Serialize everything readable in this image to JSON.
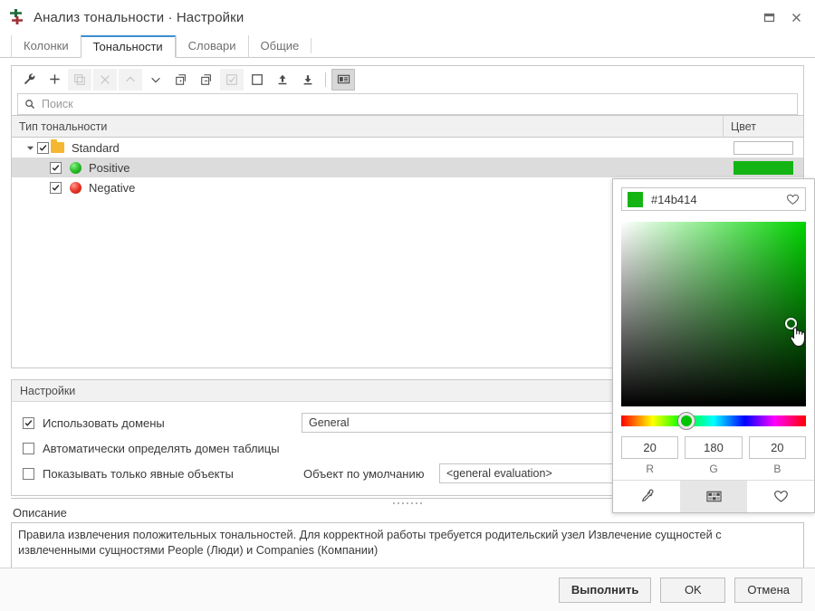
{
  "window": {
    "title": "Анализ тональности · Настройки",
    "app_icon": "sentiment-analysis-icon",
    "controls": {
      "maximize": "maximize-icon",
      "close": "close-icon"
    }
  },
  "tabs": [
    {
      "label": "Колонки",
      "active": false
    },
    {
      "label": "Тональности",
      "active": true
    },
    {
      "label": "Словари",
      "active": false
    },
    {
      "label": "Общие",
      "active": false
    }
  ],
  "toolbar": {
    "buttons": [
      {
        "icon": "wrench-icon",
        "state": "enabled"
      },
      {
        "icon": "plus-icon",
        "state": "enabled"
      },
      {
        "icon": "copy-icon",
        "state": "disabled"
      },
      {
        "icon": "delete-x-icon",
        "state": "disabled"
      },
      {
        "icon": "chevron-up-icon",
        "state": "disabled"
      },
      {
        "icon": "chevron-down-icon",
        "state": "enabled"
      },
      {
        "icon": "duplicate-add-icon",
        "state": "enabled"
      },
      {
        "icon": "duplicate-remove-icon",
        "state": "enabled"
      },
      {
        "icon": "checkbox-checked-icon",
        "state": "disabled"
      },
      {
        "icon": "checkbox-empty-icon",
        "state": "enabled"
      },
      {
        "icon": "upload-icon",
        "state": "enabled"
      },
      {
        "icon": "download-icon",
        "state": "enabled"
      },
      {
        "icon": "card-view-icon",
        "state": "pressed"
      }
    ]
  },
  "search": {
    "placeholder": "Поиск",
    "value": "",
    "icon": "search-icon"
  },
  "table": {
    "columns": [
      {
        "label": "Тип тональности"
      },
      {
        "label": "Цвет"
      }
    ],
    "rows": [
      {
        "label": "Standard",
        "icon": "folder-icon",
        "checked": true,
        "expanded": true,
        "level": 0,
        "selected": false,
        "color": ""
      },
      {
        "label": "Positive",
        "icon": "green-dot-icon",
        "checked": true,
        "level": 1,
        "selected": true,
        "color": "#14b414"
      },
      {
        "label": "Negative",
        "icon": "red-dot-icon",
        "checked": true,
        "level": 1,
        "selected": false,
        "color": ""
      }
    ]
  },
  "settings": {
    "header": "Настройки",
    "use_domains": {
      "label": "Использовать домены",
      "checked": true
    },
    "domain_value": "General",
    "auto_detect": {
      "label": "Автоматически определять домен таблицы",
      "checked": false
    },
    "explicit_only": {
      "label": "Показывать только явные объекты",
      "checked": false
    },
    "default_object_label": "Объект по умолчанию",
    "default_object_value": "<general evaluation>"
  },
  "description": {
    "label": "Описание",
    "text": "Правила извлечения положительных тональностей. Для корректной работы требуется родительский узел Извлечение сущностей с извлеченными сущностями People (Люди) и Companies (Компании)"
  },
  "footer": {
    "run": "Выполнить",
    "ok": "OK",
    "cancel": "Отмена"
  },
  "color_picker": {
    "hex": "#14b414",
    "swatch_color": "#14b414",
    "favorite_icon": "heart-icon",
    "r_label": "R",
    "g_label": "G",
    "b_label": "B",
    "r": "20",
    "g": "180",
    "b": "20",
    "tabs": [
      {
        "icon": "eyedropper-icon",
        "active": false
      },
      {
        "icon": "palette-grid-icon",
        "active": true
      },
      {
        "icon": "heart-icon",
        "active": false
      }
    ]
  }
}
